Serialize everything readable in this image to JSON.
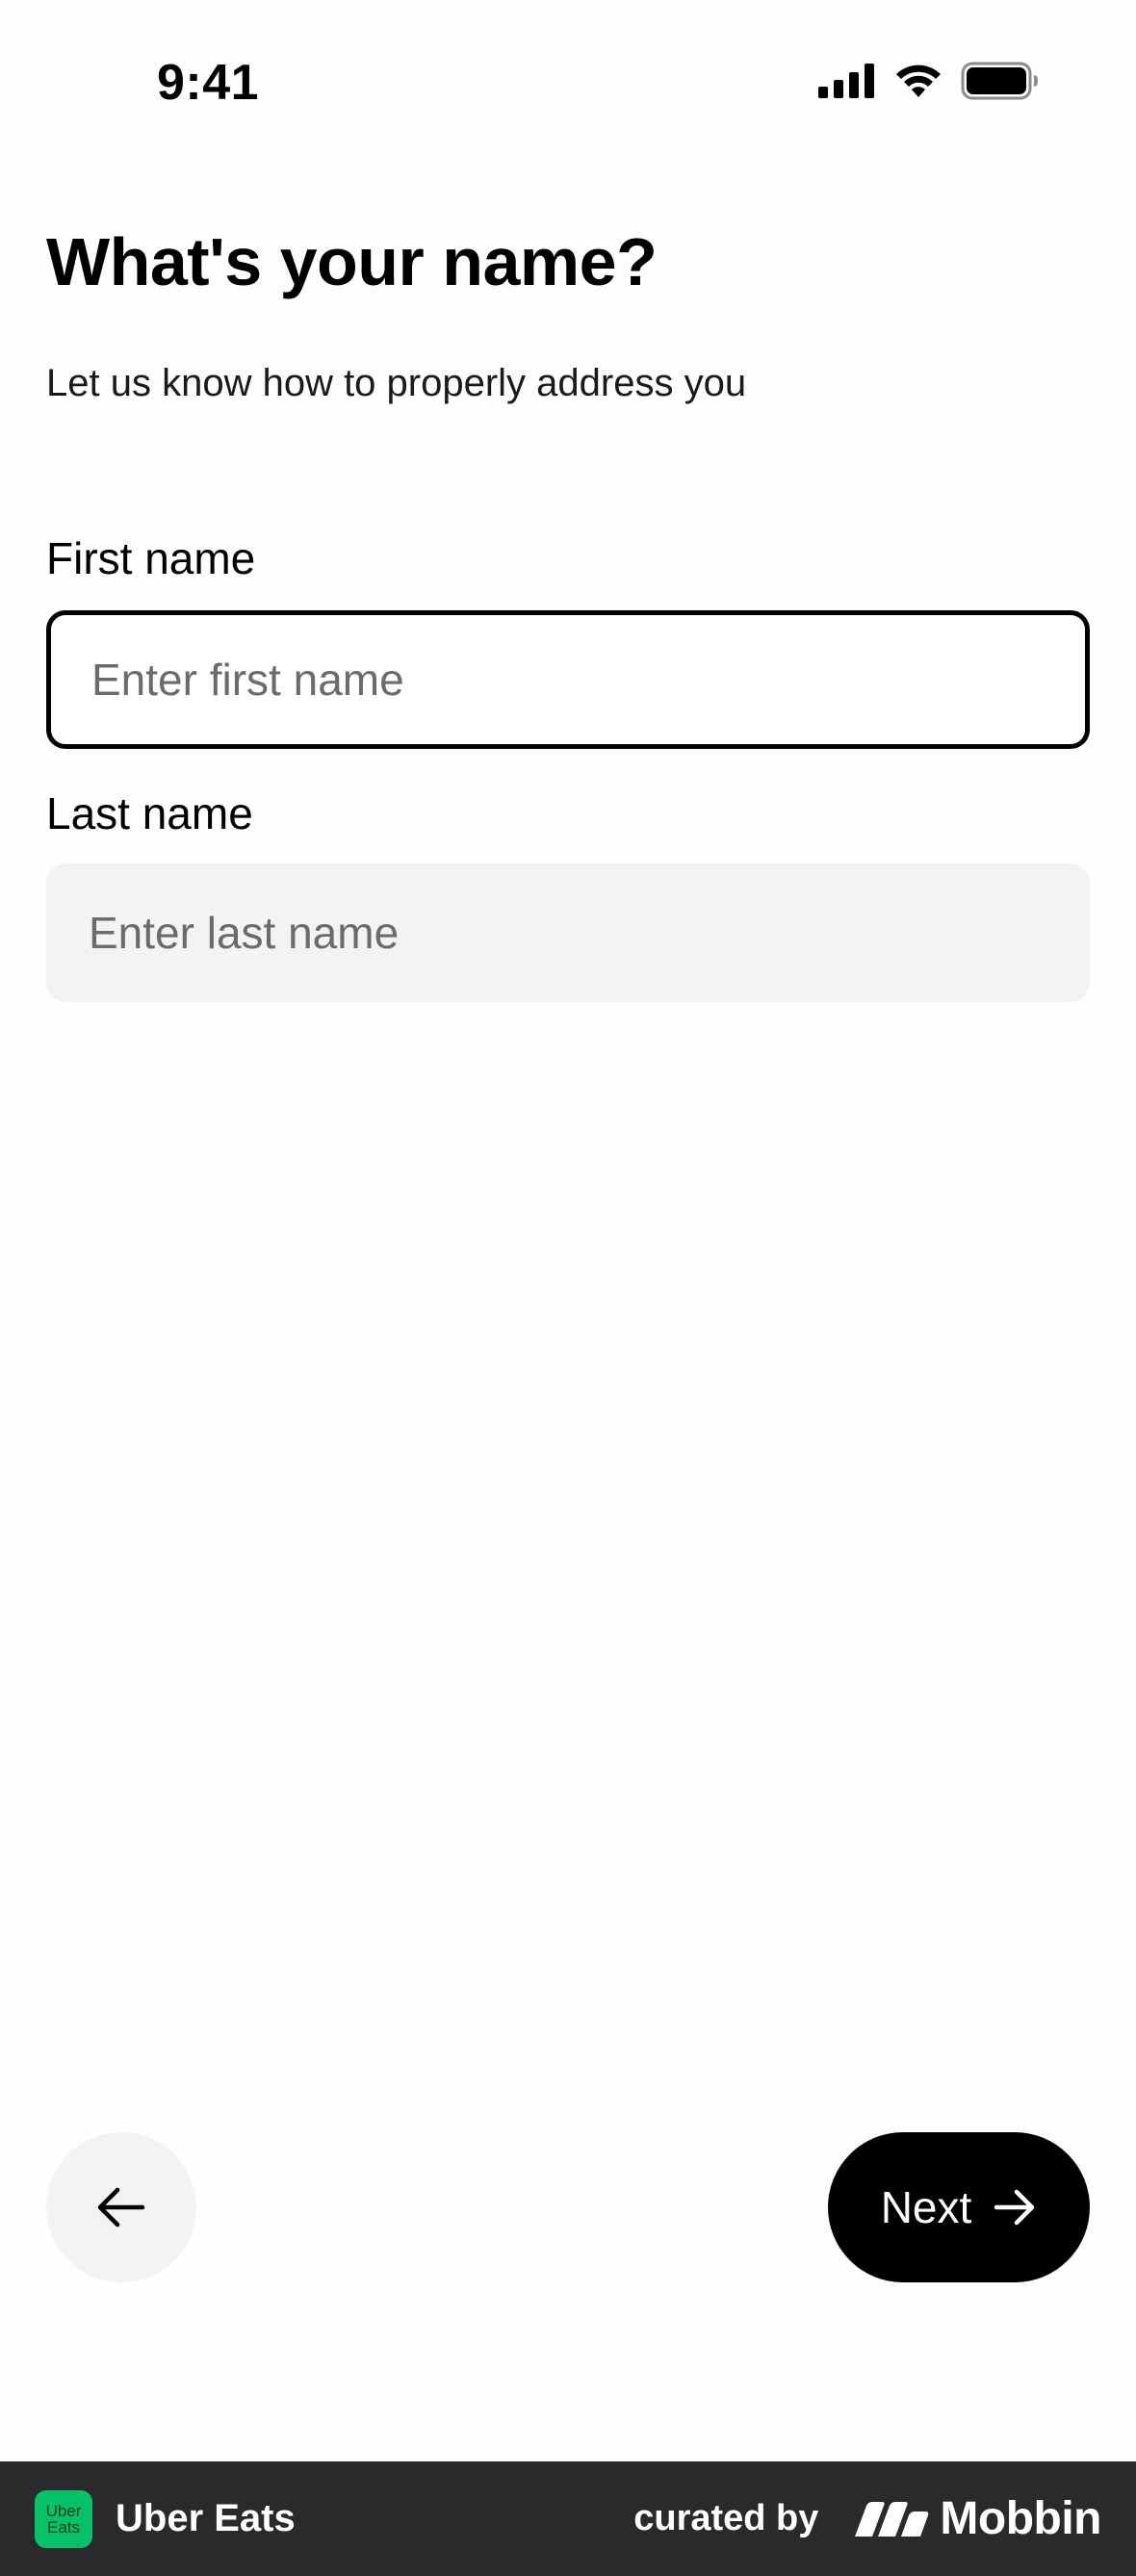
{
  "status_bar": {
    "time": "9:41"
  },
  "header": {
    "title": "What's your name?",
    "subtitle": "Let us know how to properly address you"
  },
  "form": {
    "first_name": {
      "label": "First name",
      "value": "",
      "placeholder": "Enter first name"
    },
    "last_name": {
      "label": "Last name",
      "value": "",
      "placeholder": "Enter last name"
    }
  },
  "navigation": {
    "back_icon": "arrow-left-icon",
    "next_label": "Next",
    "next_icon": "arrow-right-icon"
  },
  "footer": {
    "app_logo_text": [
      "Uber",
      "Eats"
    ],
    "app_name": "Uber Eats",
    "curated_label": "curated by",
    "brand_name": "Mobbin"
  },
  "colors": {
    "accent": "#000000",
    "input_fill": "#f3f2f5",
    "placeholder": "#6b6b6b",
    "footer_bg": "#2a2a2c",
    "app_logo": "#06c167"
  }
}
